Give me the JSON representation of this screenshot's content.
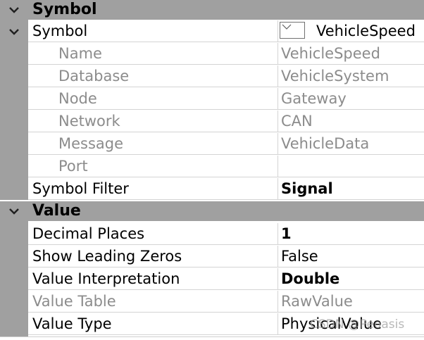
{
  "sections": {
    "symbol": {
      "label": "Symbol"
    },
    "value": {
      "label": "Value"
    }
  },
  "symbol_rows": {
    "symbol": {
      "name": "Symbol",
      "value": "VehicleSpeed"
    },
    "name": {
      "name": "Name",
      "value": "VehicleSpeed"
    },
    "database": {
      "name": "Database",
      "value": "VehicleSystem"
    },
    "node": {
      "name": "Node",
      "value": "Gateway"
    },
    "network": {
      "name": "Network",
      "value": "CAN"
    },
    "message": {
      "name": "Message",
      "value": "VehicleData"
    },
    "port": {
      "name": "Port",
      "value": ""
    },
    "symbol_filter": {
      "name": "Symbol Filter",
      "value": "Signal"
    }
  },
  "value_rows": {
    "decimal_places": {
      "name": "Decimal Places",
      "value": "1"
    },
    "show_leading_zeros": {
      "name": "Show Leading Zeros",
      "value": "False"
    },
    "value_interpretation": {
      "name": "Value Interpretation",
      "value": "Double"
    },
    "value_table": {
      "name": "Value Table",
      "value": "RawValue"
    },
    "value_type": {
      "name": "Value Type",
      "value": "PhysicalValue"
    }
  },
  "watermark": "CSDN @Peoasis",
  "icons": {
    "section_expander": "chevron-down-icon",
    "symbol_combo": "dropdown-chevron-icon"
  },
  "colors": {
    "section_bg": "#a0a0a0",
    "dim_text": "#8c8c8c",
    "grid_line": "#d4d4d4"
  }
}
